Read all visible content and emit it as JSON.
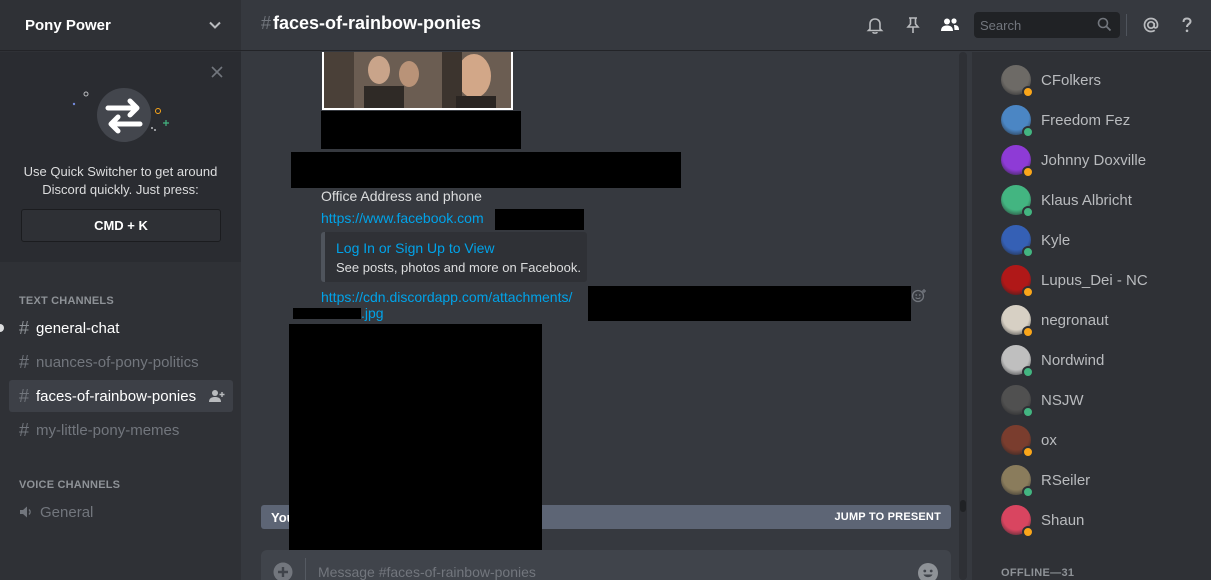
{
  "server": {
    "name": "Pony Power"
  },
  "quick_switcher": {
    "line1": "Use Quick Switcher to get around",
    "line2": "Discord quickly. Just press:",
    "shortcut": "CMD + K"
  },
  "categories": {
    "text": "TEXT CHANNELS",
    "voice": "VOICE CHANNELS"
  },
  "channels": [
    {
      "name": "general-chat",
      "state": "unread"
    },
    {
      "name": "nuances-of-pony-politics",
      "state": "muted"
    },
    {
      "name": "faces-of-rainbow-ponies",
      "state": "selected"
    },
    {
      "name": "my-little-pony-memes",
      "state": "muted"
    }
  ],
  "voice_channels": [
    {
      "name": "General"
    }
  ],
  "header": {
    "hash": "#",
    "channel": "faces-of-rainbow-ponies",
    "search_placeholder": "Search"
  },
  "messages": {
    "office_text": "Office Address and phone",
    "facebook_link": "https://www.facebook.com",
    "embed_title": "Log In or Sign Up to View",
    "embed_desc": "See posts, photos and more on Facebook.",
    "attachment_link_start": "https://cdn.discordapp.com/attachments/",
    "attachment_link_end": ".jpg"
  },
  "jump_bar": {
    "older_text": "You",
    "present_label": "JUMP TO PRESENT"
  },
  "composer": {
    "placeholder": "Message #faces-of-rainbow-ponies"
  },
  "members": [
    {
      "name": "CFolkers",
      "status_color": "#faa61a",
      "avatar_color": "#6d6a66"
    },
    {
      "name": "Freedom Fez",
      "status_color": "#43b581",
      "avatar_color": "#4b86c4"
    },
    {
      "name": "Johnny Doxville",
      "status_color": "#faa61a",
      "avatar_color": "#8e3bd6"
    },
    {
      "name": "Klaus Albricht",
      "status_color": "#43b581",
      "avatar_color": "#43b581"
    },
    {
      "name": "Kyle",
      "status_color": "#43b581",
      "avatar_color": "#3560b5"
    },
    {
      "name": "Lupus_Dei - NC",
      "status_color": "#faa61a",
      "avatar_color": "#b01818"
    },
    {
      "name": "negronaut",
      "status_color": "#faa61a",
      "avatar_color": "#d7d0c4"
    },
    {
      "name": "Nordwind",
      "status_color": "#43b581",
      "avatar_color": "#bfbfbf"
    },
    {
      "name": "NSJW",
      "status_color": "#43b581",
      "avatar_color": "#505050"
    },
    {
      "name": "ox",
      "status_color": "#faa61a",
      "avatar_color": "#7a3d2e"
    },
    {
      "name": "RSeiler",
      "status_color": "#43b581",
      "avatar_color": "#8a7c5c"
    },
    {
      "name": "Shaun",
      "status_color": "#faa61a",
      "avatar_color": "#d94560"
    }
  ],
  "offline_label": "OFFLINE—31"
}
